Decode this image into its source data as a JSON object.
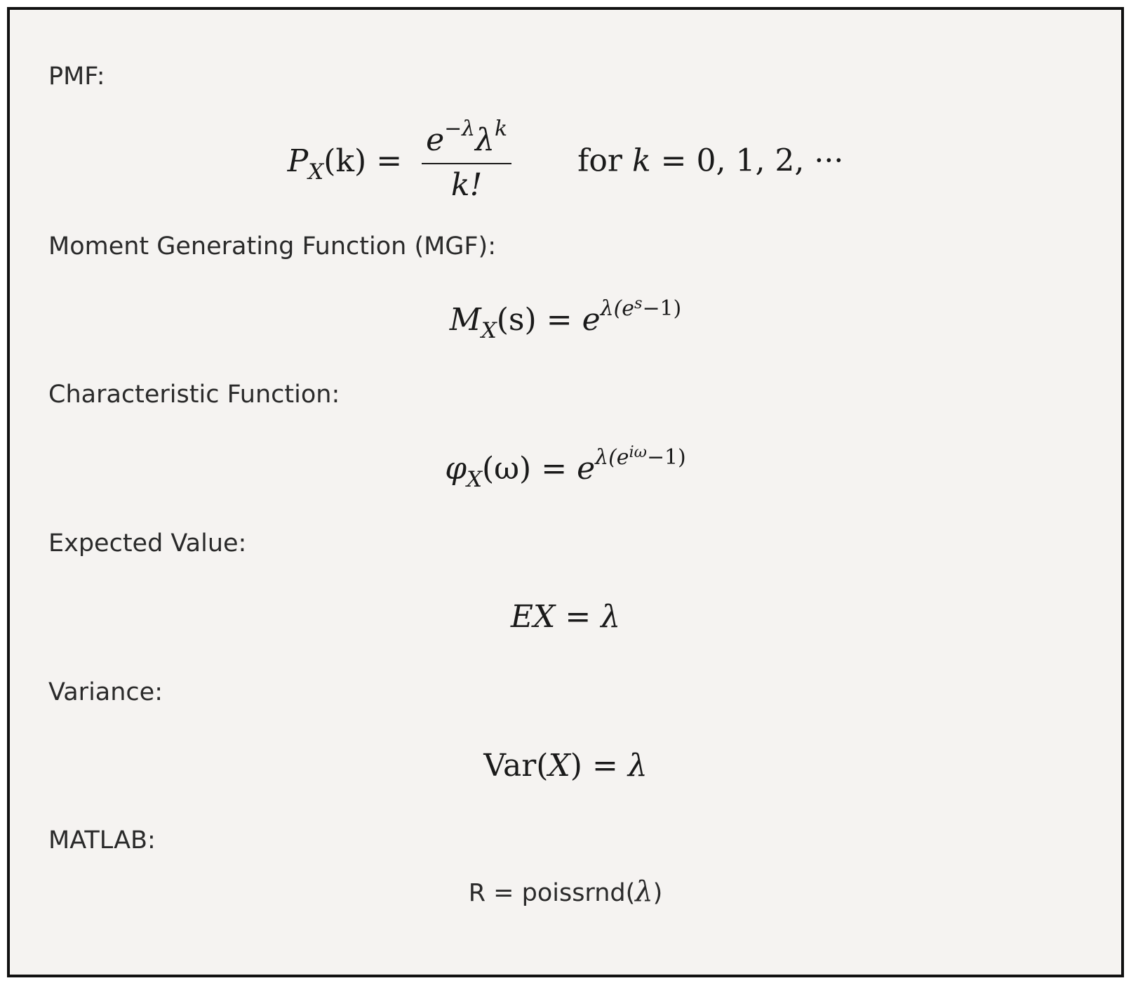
{
  "sections": [
    {
      "label": "PMF:"
    },
    {
      "label": "Moment Generating Function (MGF):"
    },
    {
      "label": "Characteristic Function:"
    },
    {
      "label": "Expected Value:"
    },
    {
      "label": "Variance:"
    },
    {
      "label": "MATLAB:"
    }
  ],
  "formulas": {
    "pmf": {
      "lhs_symbol": "P",
      "lhs_sub": "X",
      "lhs_arg": "(k)",
      "equals": "=",
      "num_base": "e",
      "num_exp": "−λ",
      "num_lambda": "λ",
      "num_lambda_exp": "k",
      "den": "k!",
      "for_word": "for",
      "domain_var": "k",
      "domain_rhs": "= 0, 1, 2, ···"
    },
    "mgf": {
      "symbol": "M",
      "sub": "X",
      "arg": "(s)",
      "equals": "=",
      "base": "e",
      "exp_pre": "λ(e",
      "exp_inner": "s",
      "exp_post": "−1)"
    },
    "cf": {
      "symbol": "φ",
      "sub": "X",
      "arg": "(ω)",
      "equals": "=",
      "base": "e",
      "exp_pre": "λ(e",
      "exp_inner": "iω",
      "exp_post": "−1)"
    },
    "ev": {
      "lhs": "EX",
      "equals": "=",
      "rhs": "λ"
    },
    "var": {
      "op": "Var",
      "arg": "(X)",
      "equals": "=",
      "rhs": "λ"
    }
  },
  "matlab": {
    "code_prefix": "R = poissrnd(",
    "code_param": "λ",
    "code_suffix": ")"
  }
}
